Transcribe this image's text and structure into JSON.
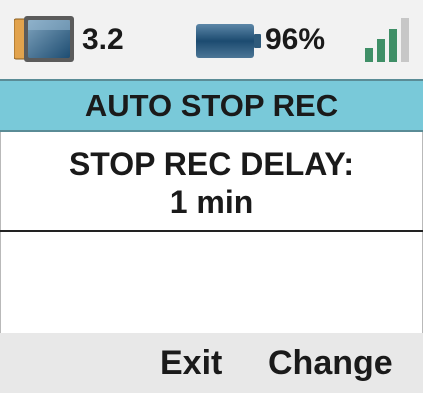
{
  "status_bar": {
    "sd_card": {
      "icon": "sd-card-icon",
      "value": "3.2"
    },
    "battery": {
      "icon": "battery-icon",
      "value": "96%",
      "level": 0.96
    },
    "signal": {
      "icon": "signal-strength-icon",
      "bars_active": 3,
      "bars_total": 4
    }
  },
  "title": "AUTO STOP REC",
  "setting": {
    "label": "STOP REC DELAY:",
    "value": "1 min"
  },
  "softkeys": {
    "left": "Exit",
    "right": "Change"
  },
  "colors": {
    "title_bg": "#79c9d9",
    "status_bg": "#f2f2f2",
    "softkey_bg": "#e8e8e8",
    "signal_active": "#3f8f67",
    "signal_inactive": "#c7c7c7"
  }
}
